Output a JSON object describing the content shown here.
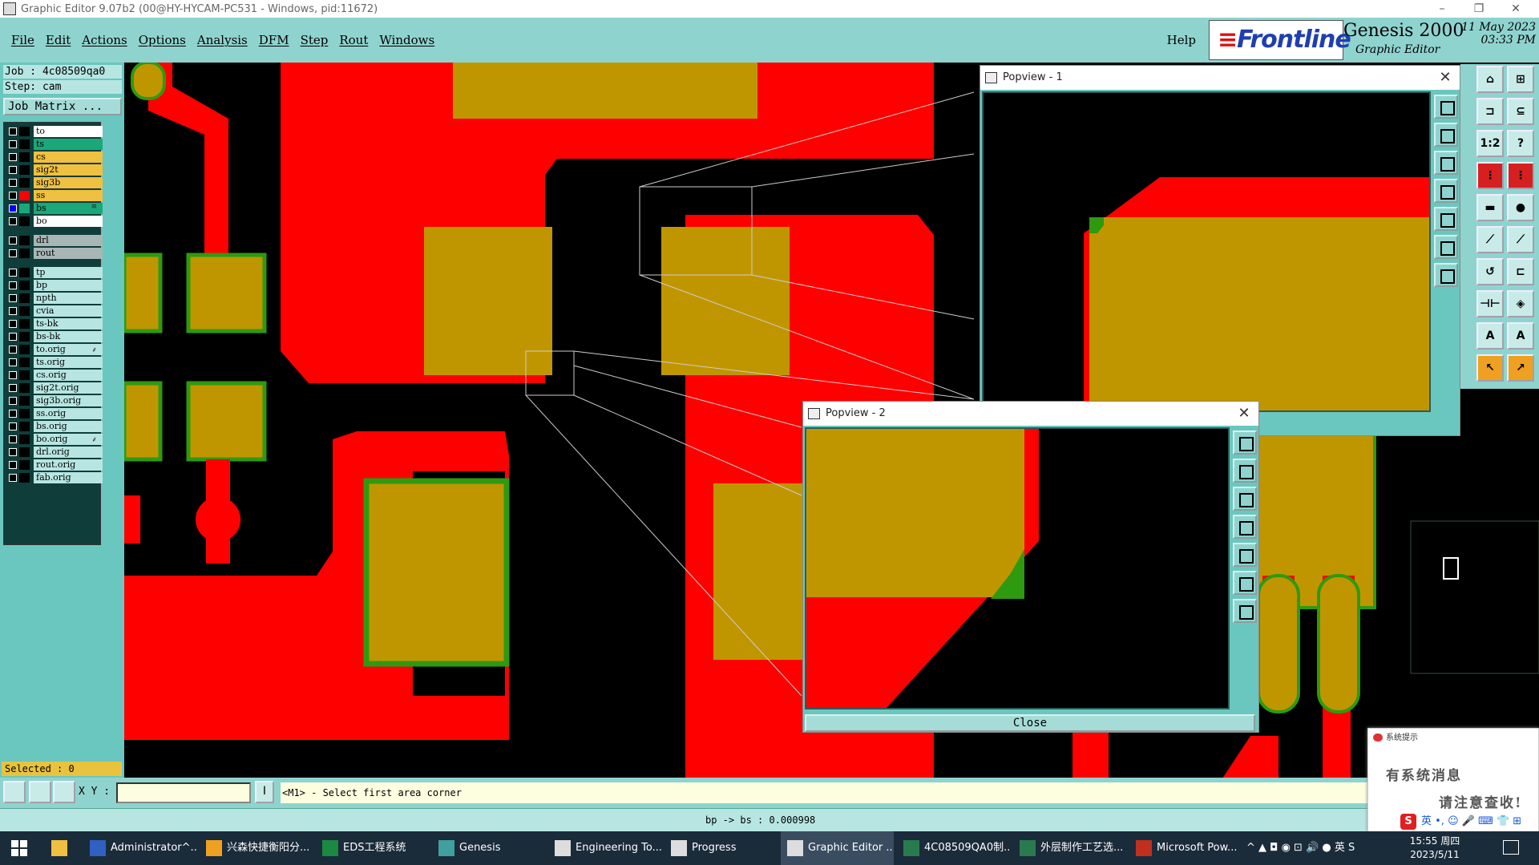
{
  "window": {
    "title": "Graphic Editor 9.07b2 (00@HY-HYCAM-PC531 - Windows, pid:11672)",
    "min_glyph": "–",
    "max_glyph": "❐",
    "close_glyph": "✕"
  },
  "menu": [
    "File",
    "Edit",
    "Actions",
    "Options",
    "Analysis",
    "DFM",
    "Step",
    "Rout",
    "Windows"
  ],
  "help_label": "Help",
  "brand": {
    "logo": "Frontline",
    "logo_bars": "≡",
    "product": "Genesis 2000",
    "subtitle": "Graphic Editor",
    "date": "11 May 2023",
    "time": "03:33 PM"
  },
  "job": {
    "job_line": "Job : 4c08509qa0",
    "step_line": "Step: cam",
    "matrix_button": "Job Matrix ..."
  },
  "layers": [
    {
      "name": "to",
      "bg": "#ffffff",
      "swatch": "#000000",
      "checked": false,
      "mark": ""
    },
    {
      "name": "ts",
      "bg": "#1aa87a",
      "swatch": "#000000",
      "checked": false,
      "mark": ""
    },
    {
      "name": "cs",
      "bg": "#f0c040",
      "swatch": "#000000",
      "checked": false,
      "mark": ""
    },
    {
      "name": "sig2t",
      "bg": "#f0c040",
      "swatch": "#000000",
      "checked": false,
      "mark": ""
    },
    {
      "name": "sig3b",
      "bg": "#f0c040",
      "swatch": "#000000",
      "checked": false,
      "mark": ""
    },
    {
      "name": "ss",
      "bg": "#f0c040",
      "swatch": "#ff0000",
      "checked": false,
      "mark": ""
    },
    {
      "name": "bs",
      "bg": "#1aa87a",
      "swatch": "#1aa87a",
      "checked": true,
      "mark": "≡"
    },
    {
      "name": "bo",
      "bg": "#ffffff",
      "swatch": "#000000",
      "checked": false,
      "mark": ""
    },
    {
      "name": "drl",
      "bg": "#a9b6b6",
      "swatch": "#000000",
      "checked": false,
      "mark": ""
    },
    {
      "name": "rout",
      "bg": "#a9b6b6",
      "swatch": "#000000",
      "checked": false,
      "mark": ""
    },
    {
      "name": "tp",
      "bg": "#b7e6e2",
      "swatch": "#000000",
      "checked": false,
      "mark": ""
    },
    {
      "name": "bp",
      "bg": "#b7e6e2",
      "swatch": "#000000",
      "checked": false,
      "mark": ""
    },
    {
      "name": "npth",
      "bg": "#b7e6e2",
      "swatch": "#000000",
      "checked": false,
      "mark": ""
    },
    {
      "name": "cvia",
      "bg": "#b7e6e2",
      "swatch": "#000000",
      "checked": false,
      "mark": ""
    },
    {
      "name": "ts-bk",
      "bg": "#b7e6e2",
      "swatch": "#000000",
      "checked": false,
      "mark": ""
    },
    {
      "name": "bs-bk",
      "bg": "#b7e6e2",
      "swatch": "#000000",
      "checked": false,
      "mark": ""
    },
    {
      "name": "to.orig",
      "bg": "#b7e6e2",
      "swatch": "#000000",
      "checked": false,
      "mark": "⸙"
    },
    {
      "name": "ts.orig",
      "bg": "#b7e6e2",
      "swatch": "#000000",
      "checked": false,
      "mark": ""
    },
    {
      "name": "cs.orig",
      "bg": "#b7e6e2",
      "swatch": "#000000",
      "checked": false,
      "mark": ""
    },
    {
      "name": "sig2t.orig",
      "bg": "#b7e6e2",
      "swatch": "#000000",
      "checked": false,
      "mark": ""
    },
    {
      "name": "sig3b.orig",
      "bg": "#b7e6e2",
      "swatch": "#000000",
      "checked": false,
      "mark": ""
    },
    {
      "name": "ss.orig",
      "bg": "#b7e6e2",
      "swatch": "#000000",
      "checked": false,
      "mark": ""
    },
    {
      "name": "bs.orig",
      "bg": "#b7e6e2",
      "swatch": "#000000",
      "checked": false,
      "mark": ""
    },
    {
      "name": "bo.orig",
      "bg": "#b7e6e2",
      "swatch": "#000000",
      "checked": false,
      "mark": "⸙"
    },
    {
      "name": "drl.orig",
      "bg": "#b7e6e2",
      "swatch": "#000000",
      "checked": false,
      "mark": ""
    },
    {
      "name": "rout.orig",
      "bg": "#b7e6e2",
      "swatch": "#000000",
      "checked": false,
      "mark": ""
    },
    {
      "name": "fab.orig",
      "bg": "#b7e6e2",
      "swatch": "#000000",
      "checked": false,
      "mark": ""
    }
  ],
  "selected_label": "Selected : 0",
  "popview1": {
    "title": "Popview - 1"
  },
  "popview2": {
    "title": "Popview - 2",
    "close_label": "Close"
  },
  "command": {
    "xy_label": "X Y :",
    "xy_value": "",
    "cursor_glyph": "I",
    "message": "<M1> - Select first area corner"
  },
  "status": "bp -> bs : 0.000998",
  "notification": {
    "title": "系统提示",
    "line1": "有系统消息",
    "line2": "请注意查收!",
    "ime_label": "英 •, ☺ 🎤 ⌨ 👕 ⊞",
    "ime_s": "S"
  },
  "taskbar": {
    "items": [
      "Administrator^...",
      "兴森快捷衡阳分...",
      "EDS工程系统",
      "Genesis",
      "Engineering To...",
      "Progress",
      "Graphic Editor ...",
      "4C08509QA0制...",
      "外层制作工艺选...",
      "Microsoft Pow..."
    ],
    "active_index": 6,
    "tray": "^  ▲ ◘ ◉ ⊡ 🔊 ● 英  S",
    "clock_time": "15:55 周四",
    "clock_date": "2023/5/11"
  },
  "colors": {
    "copper": "#ff0000",
    "pad": "#c09600",
    "mask": "#2e9a10",
    "panel": "#8fd3cf"
  }
}
